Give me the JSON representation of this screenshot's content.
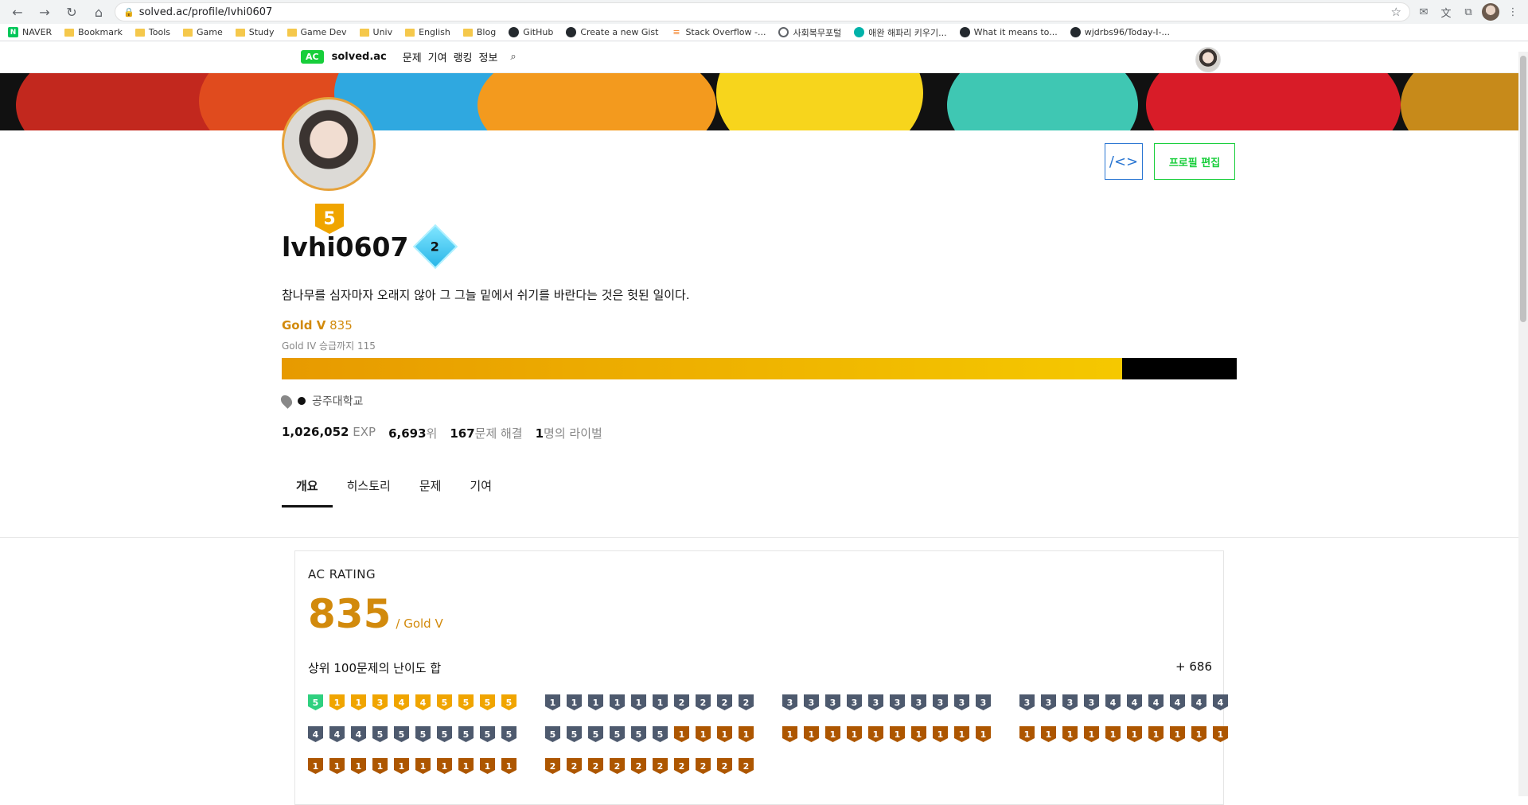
{
  "browser": {
    "url": "solved.ac/profile/lvhi0607",
    "bookmarks": [
      "NAVER",
      "Bookmark",
      "Tools",
      "Game",
      "Study",
      "Game Dev",
      "Univ",
      "English",
      "Blog",
      "GitHub",
      "Create a new Gist",
      "Stack Overflow -...",
      "사회복무포털",
      "애완 해파리 키우기...",
      "What it means to...",
      "wjdrbs96/Today-I-..."
    ]
  },
  "site": {
    "logo": "AC",
    "name": "solved.ac",
    "nav": [
      "문제",
      "기여",
      "랭킹",
      "정보"
    ]
  },
  "profile": {
    "handle": "lvhi0607",
    "badge_level": "5",
    "class_level": "2",
    "bio": "참나무를 심자마자 오래지 않아 그 그늘 밑에서 쉬기를 바란다는 것은 헛된 일이다.",
    "tier": "Gold V",
    "rating": "835",
    "next_tier_text": "Gold IV 승급까지 115",
    "exp_progress": 0.88,
    "organization": "공주대학교",
    "edit_button": "프로필 편집",
    "code_button": "/<>"
  },
  "stats": {
    "exp_value": "1,026,052",
    "exp_unit": "EXP",
    "rank_value": "6,693",
    "rank_unit": "위",
    "solved_value": "167",
    "solved_unit": "문제 해결",
    "rivals_value": "1",
    "rivals_unit": "명의 라이벌"
  },
  "tabs": [
    "개요",
    "히스토리",
    "문제",
    "기여"
  ],
  "rating_card": {
    "label": "AC RATING",
    "value": "835",
    "tier": "/ Gold V",
    "sum_label": "상위 100문제의 난이도 합",
    "sum_value": "+ 686"
  },
  "tier_grid": [
    [
      [
        [
          "ruby",
          "5"
        ],
        [
          "gold",
          "1"
        ],
        [
          "gold",
          "1"
        ],
        [
          "gold",
          "3"
        ],
        [
          "gold",
          "4"
        ],
        [
          "gold",
          "4"
        ],
        [
          "gold",
          "5"
        ],
        [
          "gold",
          "5"
        ],
        [
          "gold",
          "5"
        ],
        [
          "gold",
          "5"
        ]
      ],
      [
        [
          "silver",
          "1"
        ],
        [
          "silver",
          "1"
        ],
        [
          "silver",
          "1"
        ],
        [
          "silver",
          "1"
        ],
        [
          "silver",
          "1"
        ],
        [
          "silver",
          "1"
        ],
        [
          "silver",
          "2"
        ],
        [
          "silver",
          "2"
        ],
        [
          "silver",
          "2"
        ],
        [
          "silver",
          "2"
        ]
      ],
      [
        [
          "silver",
          "3"
        ],
        [
          "silver",
          "3"
        ],
        [
          "silver",
          "3"
        ],
        [
          "silver",
          "3"
        ],
        [
          "silver",
          "3"
        ],
        [
          "silver",
          "3"
        ],
        [
          "silver",
          "3"
        ],
        [
          "silver",
          "3"
        ],
        [
          "silver",
          "3"
        ],
        [
          "silver",
          "3"
        ]
      ],
      [
        [
          "silver",
          "3"
        ],
        [
          "silver",
          "3"
        ],
        [
          "silver",
          "3"
        ],
        [
          "silver",
          "3"
        ],
        [
          "silver",
          "4"
        ],
        [
          "silver",
          "4"
        ],
        [
          "silver",
          "4"
        ],
        [
          "silver",
          "4"
        ],
        [
          "silver",
          "4"
        ],
        [
          "silver",
          "4"
        ]
      ]
    ],
    [
      [
        [
          "silver",
          "4"
        ],
        [
          "silver",
          "4"
        ],
        [
          "silver",
          "4"
        ],
        [
          "silver",
          "5"
        ],
        [
          "silver",
          "5"
        ],
        [
          "silver",
          "5"
        ],
        [
          "silver",
          "5"
        ],
        [
          "silver",
          "5"
        ],
        [
          "silver",
          "5"
        ],
        [
          "silver",
          "5"
        ]
      ],
      [
        [
          "silver",
          "5"
        ],
        [
          "silver",
          "5"
        ],
        [
          "silver",
          "5"
        ],
        [
          "silver",
          "5"
        ],
        [
          "silver",
          "5"
        ],
        [
          "silver",
          "5"
        ],
        [
          "bronze",
          "1"
        ],
        [
          "bronze",
          "1"
        ],
        [
          "bronze",
          "1"
        ],
        [
          "bronze",
          "1"
        ]
      ],
      [
        [
          "bronze",
          "1"
        ],
        [
          "bronze",
          "1"
        ],
        [
          "bronze",
          "1"
        ],
        [
          "bronze",
          "1"
        ],
        [
          "bronze",
          "1"
        ],
        [
          "bronze",
          "1"
        ],
        [
          "bronze",
          "1"
        ],
        [
          "bronze",
          "1"
        ],
        [
          "bronze",
          "1"
        ],
        [
          "bronze",
          "1"
        ]
      ],
      [
        [
          "bronze",
          "1"
        ],
        [
          "bronze",
          "1"
        ],
        [
          "bronze",
          "1"
        ],
        [
          "bronze",
          "1"
        ],
        [
          "bronze",
          "1"
        ],
        [
          "bronze",
          "1"
        ],
        [
          "bronze",
          "1"
        ],
        [
          "bronze",
          "1"
        ],
        [
          "bronze",
          "1"
        ],
        [
          "bronze",
          "1"
        ]
      ]
    ],
    [
      [
        [
          "bronze",
          "1"
        ],
        [
          "bronze",
          "1"
        ],
        [
          "bronze",
          "1"
        ],
        [
          "bronze",
          "1"
        ],
        [
          "bronze",
          "1"
        ],
        [
          "bronze",
          "1"
        ],
        [
          "bronze",
          "1"
        ],
        [
          "bronze",
          "1"
        ],
        [
          "bronze",
          "1"
        ],
        [
          "bronze",
          "1"
        ]
      ],
      [
        [
          "bronze",
          "2"
        ],
        [
          "bronze",
          "2"
        ],
        [
          "bronze",
          "2"
        ],
        [
          "bronze",
          "2"
        ],
        [
          "bronze",
          "2"
        ],
        [
          "bronze",
          "2"
        ],
        [
          "bronze",
          "2"
        ],
        [
          "bronze",
          "2"
        ],
        [
          "bronze",
          "2"
        ],
        [
          "bronze",
          "2"
        ]
      ]
    ]
  ]
}
